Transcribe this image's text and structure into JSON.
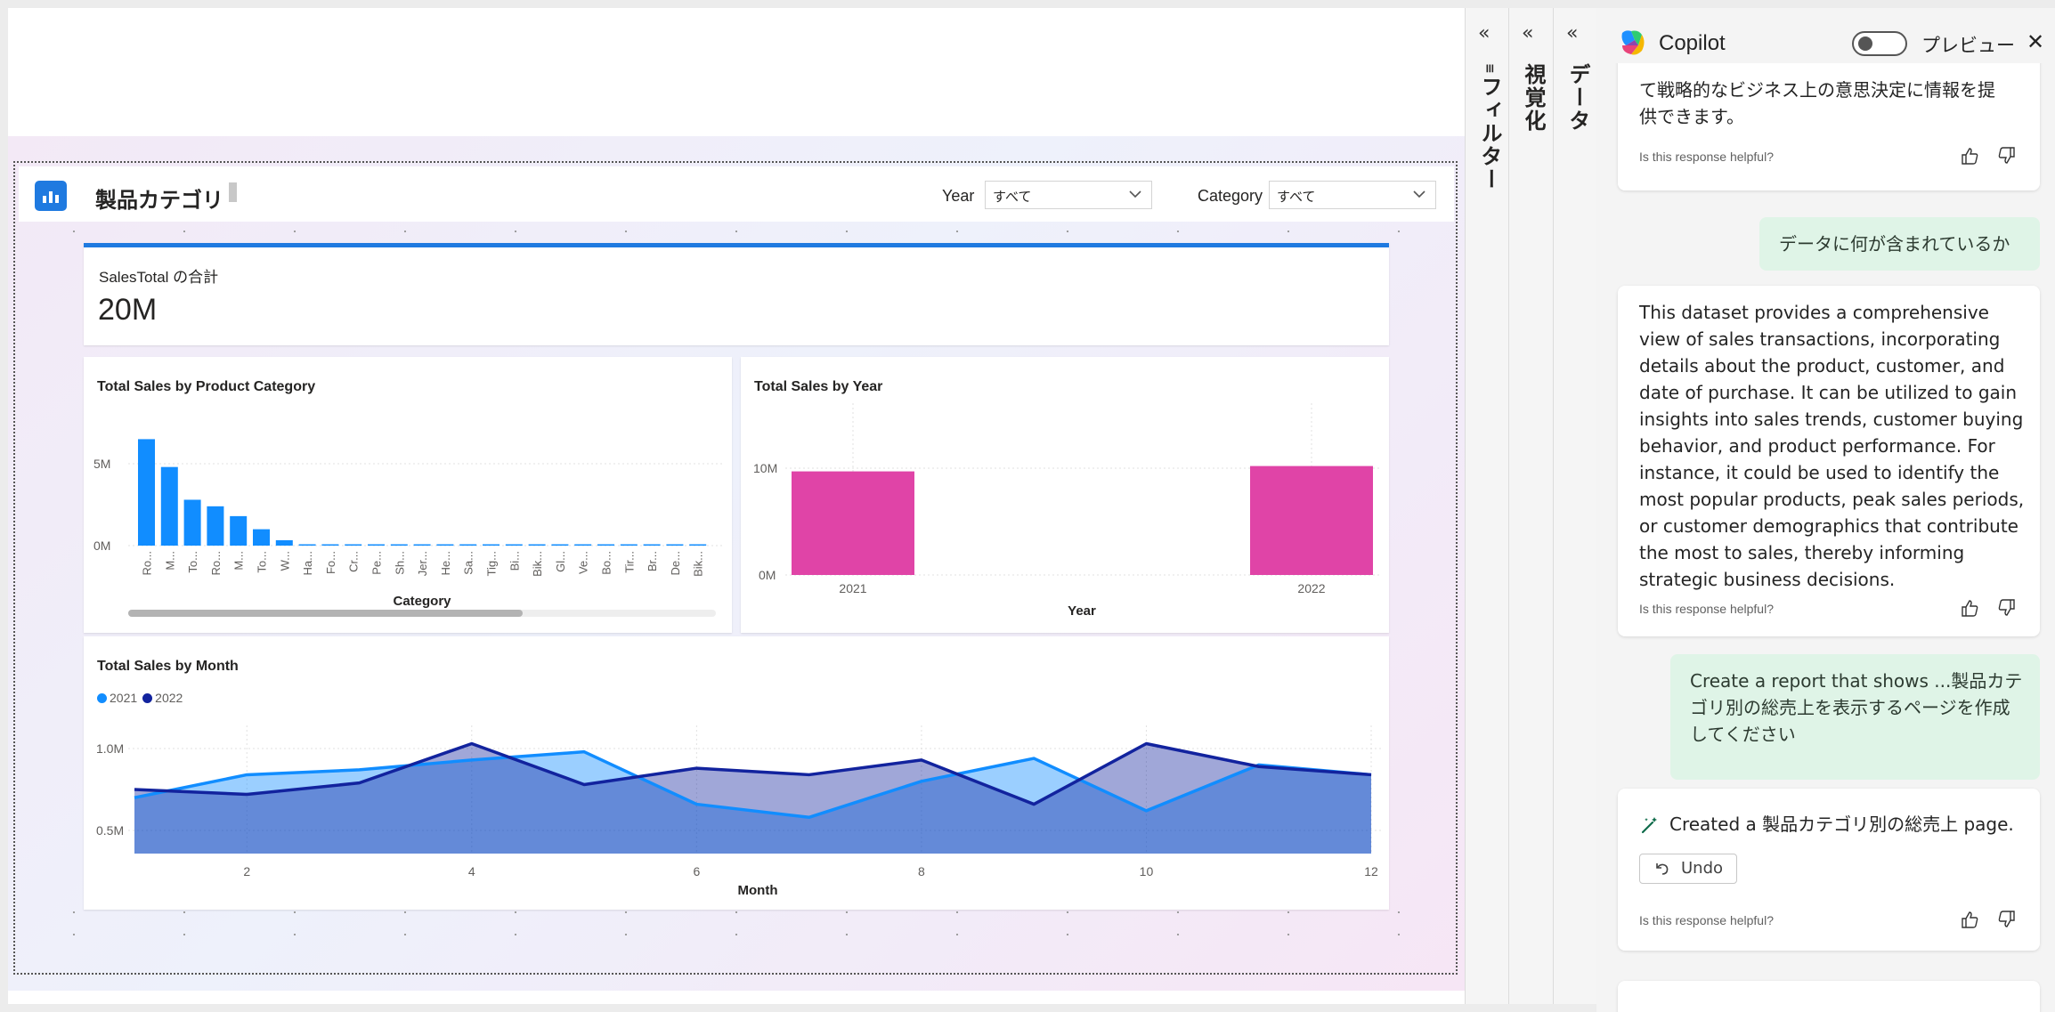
{
  "report": {
    "title": "製品カテゴリ",
    "slicers": [
      {
        "label": "Year",
        "value": "すべて"
      },
      {
        "label": "Category",
        "value": "すべて"
      }
    ]
  },
  "kpi": {
    "label": "SalesTotal の合計",
    "value": "20M",
    "accent_color": "#1f7ae0"
  },
  "visuals": {
    "category": {
      "title": "Total Sales by Product Category",
      "xlabel": "Category",
      "ylabels": [
        "5M",
        "0M"
      ],
      "color": "#118dff"
    },
    "year": {
      "title": "Total Sales by Year",
      "xlabel": "Year",
      "ylabels": [
        "10M",
        "0M"
      ],
      "color": "#e044a7"
    },
    "month": {
      "title": "Total Sales by Month",
      "xlabel": "Month",
      "ylabels": [
        "1.0M",
        "0.5M"
      ],
      "legend": [
        "2021",
        "2022"
      ],
      "colors": [
        "#118dff",
        "#12239e"
      ]
    }
  },
  "chart_data": [
    {
      "type": "bar",
      "title": "Total Sales by Product Category",
      "xlabel": "Category",
      "ylabel": "",
      "ylim": [
        0,
        7000000
      ],
      "categories": [
        "Ro...",
        "M...",
        "To...",
        "Ro...",
        "M...",
        "To...",
        "W...",
        "Ha...",
        "Fo...",
        "Cr...",
        "Pe...",
        "Sh...",
        "Jer...",
        "He...",
        "Sa...",
        "Tig...",
        "Bi...",
        "Bik...",
        "Gl...",
        "Ve...",
        "Bo...",
        "Tir...",
        "Br...",
        "De...",
        "Bik..."
      ],
      "values": [
        6500000,
        4800000,
        2800000,
        2400000,
        1800000,
        1000000,
        330000,
        60000,
        40000,
        30000,
        25000,
        20000,
        18000,
        16000,
        14000,
        12000,
        11000,
        10000,
        9000,
        8000,
        7000,
        6000,
        5000,
        4000,
        3000
      ],
      "grid": true
    },
    {
      "type": "bar",
      "title": "Total Sales by Year",
      "xlabel": "Year",
      "ylabel": "",
      "ylim": [
        0,
        11000000
      ],
      "categories": [
        "2021",
        "2022"
      ],
      "values": [
        9700000,
        10200000
      ],
      "grid": true
    },
    {
      "type": "area",
      "title": "Total Sales by Month",
      "xlabel": "Month",
      "ylabel": "",
      "x": [
        1,
        2,
        3,
        4,
        5,
        6,
        7,
        8,
        9,
        10,
        11,
        12
      ],
      "ylim": [
        0.4,
        1.15
      ],
      "yunits": "M",
      "series": [
        {
          "name": "2021",
          "values": [
            0.7,
            0.84,
            0.87,
            0.93,
            0.98,
            0.66,
            0.58,
            0.8,
            0.94,
            0.62,
            0.9,
            0.84
          ]
        },
        {
          "name": "2022",
          "values": [
            0.75,
            0.72,
            0.79,
            1.03,
            0.78,
            0.88,
            0.84,
            0.93,
            0.66,
            1.03,
            0.89,
            0.84
          ]
        }
      ],
      "grid": true,
      "legend": "top-left"
    }
  ],
  "panes": {
    "filters_label": "フィルター",
    "visualizations_label": "視覚化",
    "data_label": "データ"
  },
  "copilot": {
    "title": "Copilot",
    "preview_label": "プレビュー",
    "helpful_prompt": "Is this response helpful?",
    "msg1_lines": [
      "て戦略的なビジネス上の意思決定に情報を提",
      "供できます。"
    ],
    "user1": "データに何が含まれているか",
    "ai2": "This dataset provides a comprehensive view of sales transactions, incorporating details about the product, customer, and date of purchase. It can be utilized to gain insights into sales trends, customer buying behavior, and product performance. For instance, it could be used to identify the most popular products, peak sales periods, or customer demographics that contribute the most to sales, thereby informing strategic business decisions.",
    "user2": "Create a report that shows ...製品カテゴリ別の総売上を表示するページを作成してください",
    "created": "Created a 製品カテゴリ別の総売上 page.",
    "undo_label": "Undo"
  }
}
